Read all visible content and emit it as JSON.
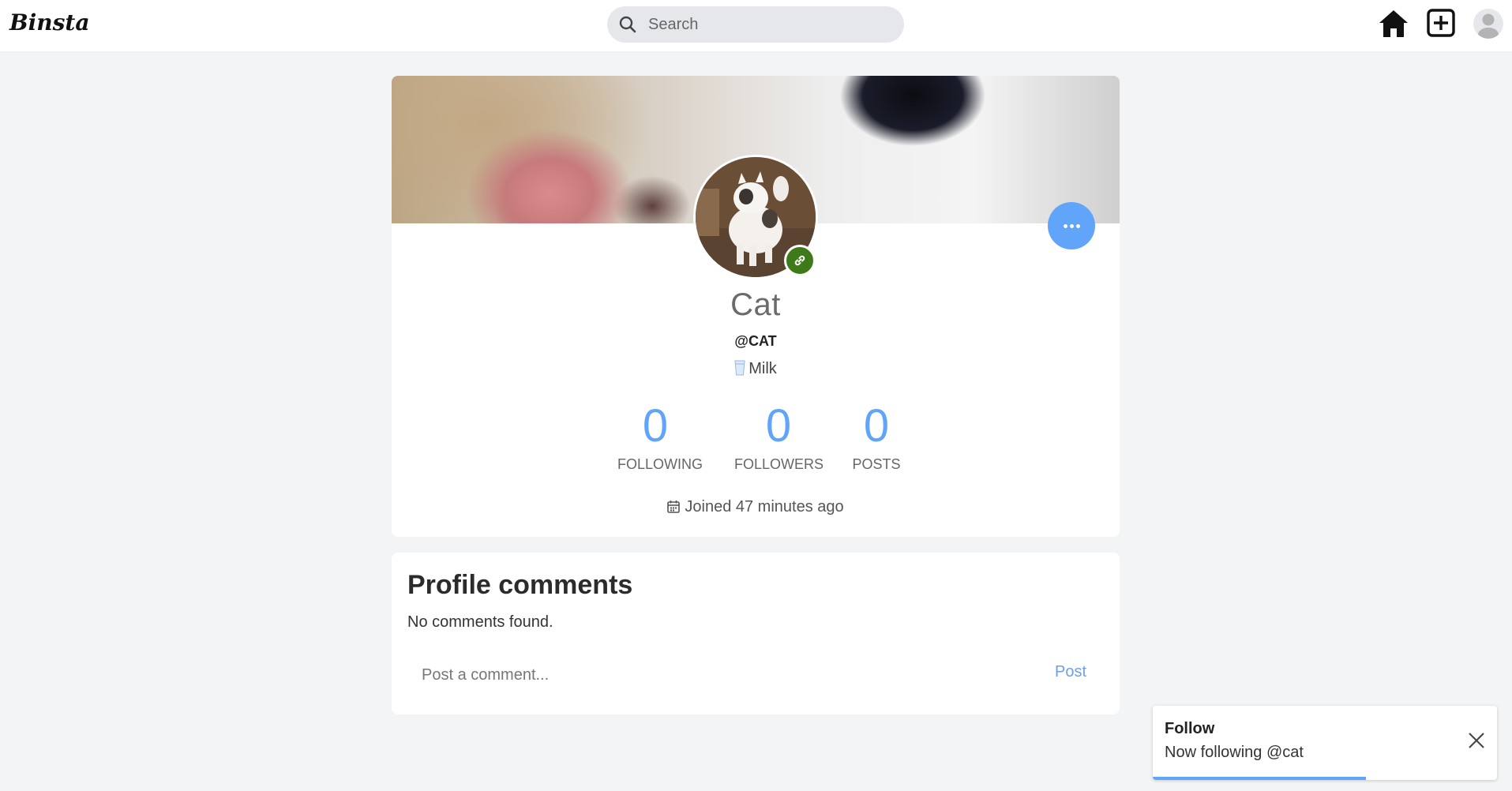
{
  "app": {
    "logo": "Binsta"
  },
  "search": {
    "placeholder": "Search"
  },
  "nav": {
    "icons": [
      "home-icon",
      "add-post-icon",
      "user-avatar-icon"
    ]
  },
  "profile": {
    "display_name": "Cat",
    "handle": "@CAT",
    "bio": "Milk",
    "bio_icon": "milk-glass-icon",
    "stats": [
      {
        "value": "0",
        "label": "FOLLOWING"
      },
      {
        "value": "0",
        "label": "FOLLOWERS"
      },
      {
        "value": "0",
        "label": "POSTS"
      }
    ],
    "joined": "Joined 47 minutes ago",
    "more_icon": "ellipsis-icon",
    "badge_icon": "link-icon"
  },
  "comments": {
    "title": "Profile comments",
    "empty_text": "No comments found.",
    "input_placeholder": "Post a comment...",
    "post_label": "Post"
  },
  "toast": {
    "title": "Follow",
    "message": "Now following @cat",
    "progress": 0.62
  },
  "colors": {
    "accent": "#60a5fa",
    "badge": "#3f7a1a",
    "background": "#f3f4f6"
  }
}
